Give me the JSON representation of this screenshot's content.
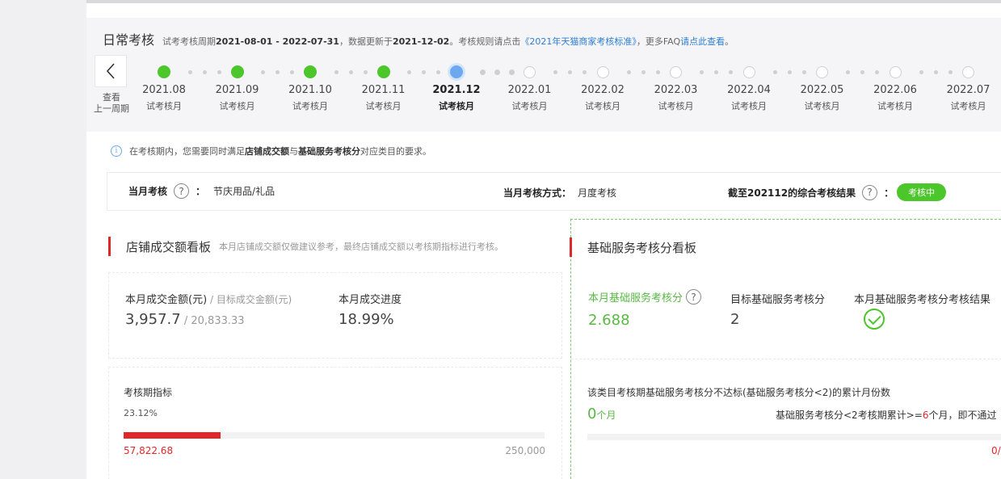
{
  "header": {
    "title": "日常考核",
    "desc": {
      "prefix": "试考考核周期",
      "period": "2021-08-01 - 2022-07-31",
      "mid": "，数据更新于",
      "updated": "2021-12-02",
      "rule_prefix": "。考核规则请点击",
      "rule_link": "《2021年天猫商家考核标准》",
      "faq_prefix": "，更多FAQ",
      "faq_link": "请点此查看",
      "suffix": "。"
    },
    "prev_label_line1": "查看",
    "prev_label_line2": "上一周期",
    "prev_icon": "chevron-left-icon"
  },
  "timeline": [
    {
      "month": "2021.08",
      "sub": "试考核月",
      "state": "done"
    },
    {
      "month": "2021.09",
      "sub": "试考核月",
      "state": "done"
    },
    {
      "month": "2021.10",
      "sub": "试考核月",
      "state": "done"
    },
    {
      "month": "2021.11",
      "sub": "试考核月",
      "state": "done"
    },
    {
      "month": "2021.12",
      "sub": "试考核月",
      "state": "current"
    },
    {
      "month": "2022.01",
      "sub": "试考核月",
      "state": "future"
    },
    {
      "month": "2022.02",
      "sub": "试考核月",
      "state": "future"
    },
    {
      "month": "2022.03",
      "sub": "试考核月",
      "state": "future"
    },
    {
      "month": "2022.04",
      "sub": "试考核月",
      "state": "future"
    },
    {
      "month": "2022.05",
      "sub": "试考核月",
      "state": "future"
    },
    {
      "month": "2022.06",
      "sub": "试考核月",
      "state": "future"
    },
    {
      "month": "2022.07",
      "sub": "试考核月",
      "state": "future"
    }
  ],
  "notice": {
    "pre": "在考核期内，您需要同时满足",
    "b1": "店铺成交额",
    "mid": "与",
    "b2": "基础服务考核分",
    "post": "对应类目的要求。"
  },
  "assess": {
    "current_label": "当月考核",
    "colon": "：",
    "category": "节庆用品/礼品",
    "method_label": "当月考核方式：",
    "method_value": "月度考核",
    "result_label": "截至202112的综合考核结果",
    "result_colon": "：",
    "status": "考核中"
  },
  "sales": {
    "title": "店铺成交额看板",
    "desc": "本月店铺成交额仅做建议参考，最终店铺成交额以考核期指标进行考核。",
    "amount_label": "本月成交金额(元)",
    "target_label": " / 目标成交金额(元)",
    "amount": "3,957.7",
    "slash": " / ",
    "target": "20,833.33",
    "progress_label": "本月成交进度",
    "progress": "18.99%",
    "period_label": "考核期指标",
    "period_percent": "23.12%",
    "period_fraction": 0.2312,
    "period_current": "57,822.68",
    "period_target": "250,000"
  },
  "service": {
    "title": "基础服务考核分看板",
    "score_label": "本月基础服务考核分",
    "score": "2.688",
    "target_label": "目标基础服务考核分",
    "target": "2",
    "result_label": "本月基础服务考核分考核结果",
    "result_icon": "check-circle-icon",
    "fail_label": "该类目考核期基础服务考核分不达标(基础服务考核分<2)的累计月份数",
    "fail_count": "0",
    "fail_unit": "个月",
    "rule_pre": "基础服务考核分<2考核期累计>=",
    "rule_num": "6",
    "rule_post": "个月，即不通过",
    "right_value": "0/"
  },
  "colors": {
    "green": "#4bc62b",
    "red": "#e0272a",
    "blue": "#2d7fd2",
    "current_dot": "#6ca8f0"
  }
}
